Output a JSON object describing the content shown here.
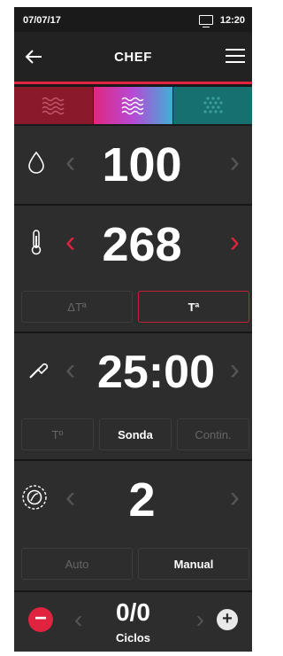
{
  "status": {
    "date": "07/07/17",
    "time": "12:20"
  },
  "appbar": {
    "back_icon": "arrow-left-icon",
    "title": "CHEF",
    "menu_icon": "hamburger-icon"
  },
  "modes": [
    {
      "name": "steam",
      "icon": "wave-icon",
      "color": "#8a1a2b"
    },
    {
      "name": "combi",
      "icon": "wave-icon",
      "color": "#b64ad6"
    },
    {
      "name": "convection",
      "icon": "dots-icon",
      "color": "#15706f"
    }
  ],
  "humidity": {
    "icon": "drop-icon",
    "value": "100"
  },
  "temperature": {
    "icon": "thermometer-icon",
    "value": "268",
    "btn_delta": "ΔTª",
    "btn_t": "Tª"
  },
  "time": {
    "icon": "probe-icon",
    "value": "25:00",
    "btn_t": "Tº",
    "btn_sonda": "Sonda",
    "btn_contin": "Contin."
  },
  "fan": {
    "icon": "fan-icon",
    "value": "2",
    "btn_auto": "Auto",
    "btn_manual": "Manual"
  },
  "cycles": {
    "value": "0/0",
    "label": "Ciclos",
    "minus": "−",
    "plus": "+"
  }
}
